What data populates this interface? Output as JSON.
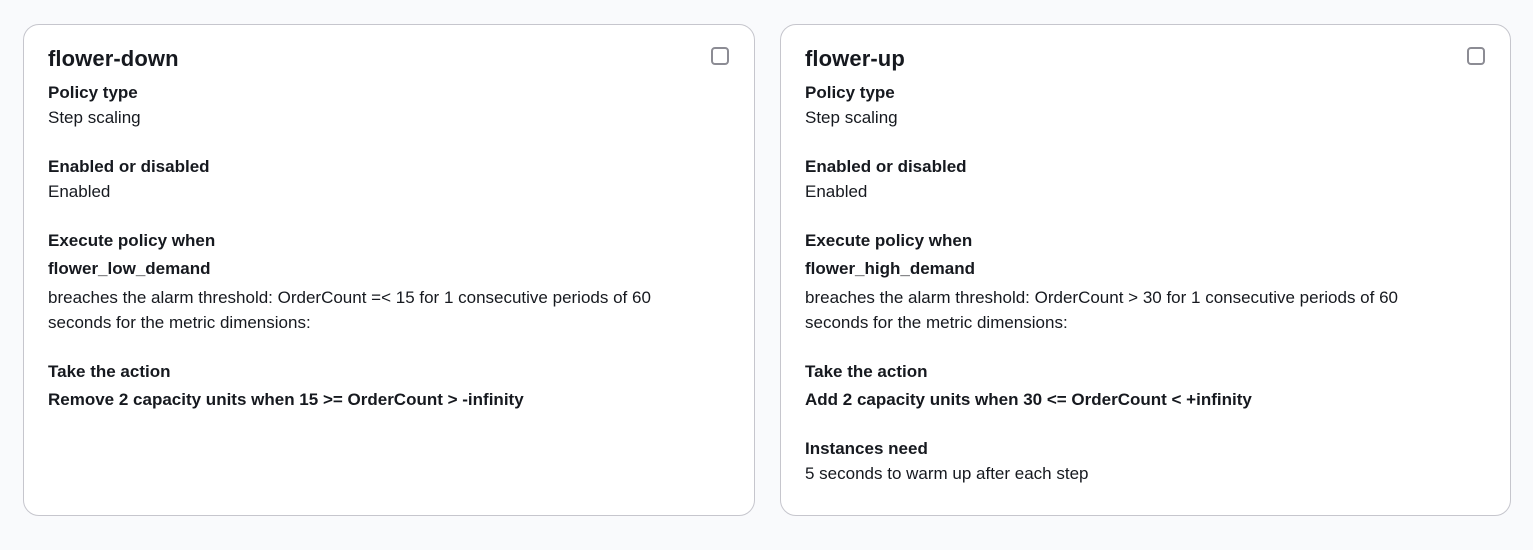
{
  "policies": [
    {
      "name": "flower-down",
      "policy_type_label": "Policy type",
      "policy_type": "Step scaling",
      "enabled_label": "Enabled or disabled",
      "enabled": "Enabled",
      "execute_label": "Execute policy when",
      "alarm_name": "flower_low_demand",
      "alarm_description": "breaches the alarm threshold: OrderCount =< 15 for 1 consecutive periods of 60 seconds for the metric dimensions:",
      "action_label": "Take the action",
      "action": "Remove 2 capacity units when 15 >= OrderCount > -infinity"
    },
    {
      "name": "flower-up",
      "policy_type_label": "Policy type",
      "policy_type": "Step scaling",
      "enabled_label": "Enabled or disabled",
      "enabled": "Enabled",
      "execute_label": "Execute policy when",
      "alarm_name": "flower_high_demand",
      "alarm_description": "breaches the alarm threshold: OrderCount > 30 for 1 consecutive periods of 60 seconds for the metric dimensions:",
      "action_label": "Take the action",
      "action": "Add 2 capacity units when 30 <= OrderCount < +infinity",
      "warmup_label": "Instances need",
      "warmup": "5 seconds to warm up after each step"
    }
  ]
}
